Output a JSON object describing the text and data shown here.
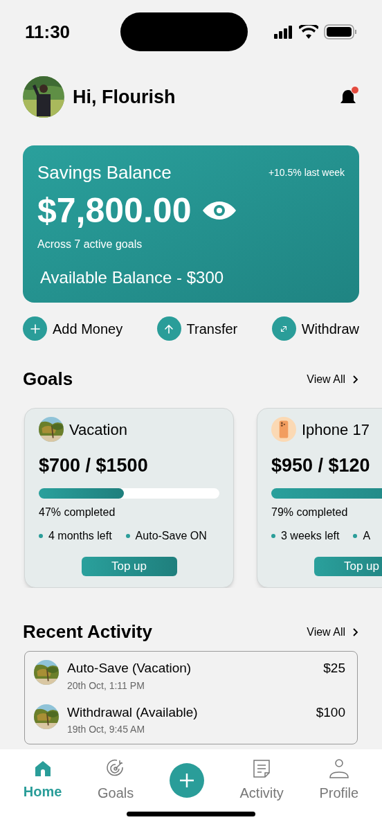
{
  "status_bar": {
    "time": "11:30"
  },
  "header": {
    "greeting": "Hi, Flourish",
    "notification": {
      "unread": true
    }
  },
  "balance_card": {
    "title": "Savings Balance",
    "change": "+10.5% last week",
    "amount": "$7,800.00",
    "subtitle": "Across 7 active goals",
    "available": "Available Balance - $300"
  },
  "actions": [
    {
      "label": "Add Money",
      "kind": "add"
    },
    {
      "label": "Transfer",
      "kind": "transfer"
    },
    {
      "label": "Withdraw",
      "kind": "withdraw"
    }
  ],
  "goals": {
    "title": "Goals",
    "view_all": "View All",
    "items": [
      {
        "name": "Vacation",
        "kind": "palm",
        "amount": "$700 / $1500",
        "level": 0.47,
        "progress_text": "47% completed",
        "time_left": "4 months left",
        "auto_save": "Auto-Save ON",
        "button": "Top up"
      },
      {
        "name": "Iphone 17",
        "kind": "phone",
        "amount": "$950 / $120",
        "progress_text": "79% completed",
        "time_left": "3 weeks left",
        "auto_save": "A",
        "button": "Top up"
      }
    ]
  },
  "activity": {
    "title": "Recent Activity",
    "view_all": "View All",
    "items": [
      {
        "title": "Auto-Save (Vacation)",
        "date": "20th Oct, 1:11 PM",
        "amount": "$25"
      },
      {
        "title": "Withdrawal (Available)",
        "date": "19th Oct, 9:45 AM",
        "amount": "$100"
      }
    ]
  },
  "nav": [
    {
      "kind": "home",
      "label": "Home",
      "selected": true
    },
    {
      "kind": "goals",
      "label": "Goals",
      "selected": false
    },
    {
      "kind": "add",
      "selected": false
    },
    {
      "kind": "activity",
      "label": "Activity",
      "selected": false
    },
    {
      "kind": "profile",
      "label": "Profile",
      "selected": false
    }
  ]
}
